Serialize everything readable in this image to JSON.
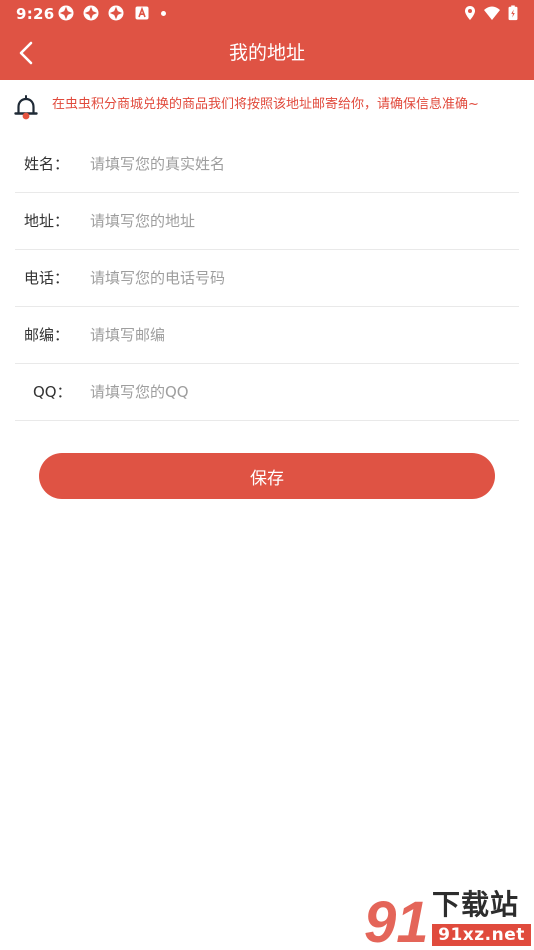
{
  "theme": {
    "primary": "#df5344",
    "notice_text": "#e14a3c",
    "label": "#333333",
    "placeholder": "#9e9e9e",
    "divider": "#e9e9e9"
  },
  "status_bar": {
    "time": "9:26",
    "left_icons": [
      "app-notification-icon",
      "app-notification-icon",
      "app-notification-icon",
      "font-a-icon",
      "more-dot-icon"
    ],
    "right_icons": [
      "location-icon",
      "wifi-icon",
      "battery-icon"
    ]
  },
  "header": {
    "title": "我的地址",
    "back_icon": "chevron-left-icon"
  },
  "notice": {
    "icon": "bell-icon",
    "text": "在虫虫积分商城兑换的商品我们将按照该地址邮寄给你，请确保信息准确~"
  },
  "form": {
    "fields": [
      {
        "key": "name",
        "label": "姓名：",
        "value": "",
        "placeholder": "请填写您的真实姓名"
      },
      {
        "key": "address",
        "label": "地址：",
        "value": "",
        "placeholder": "请填写您的地址"
      },
      {
        "key": "phone",
        "label": "电话：",
        "value": "",
        "placeholder": "请填写您的电话号码"
      },
      {
        "key": "postcode",
        "label": "邮编：",
        "value": "",
        "placeholder": "请填写邮编"
      },
      {
        "key": "qq",
        "label": "QQ：",
        "value": "",
        "placeholder": "请填写您的QQ"
      }
    ]
  },
  "save_button": {
    "label": "保存"
  },
  "watermark": {
    "logo_text": "91",
    "title": "下载站",
    "url": "91xz.net"
  }
}
